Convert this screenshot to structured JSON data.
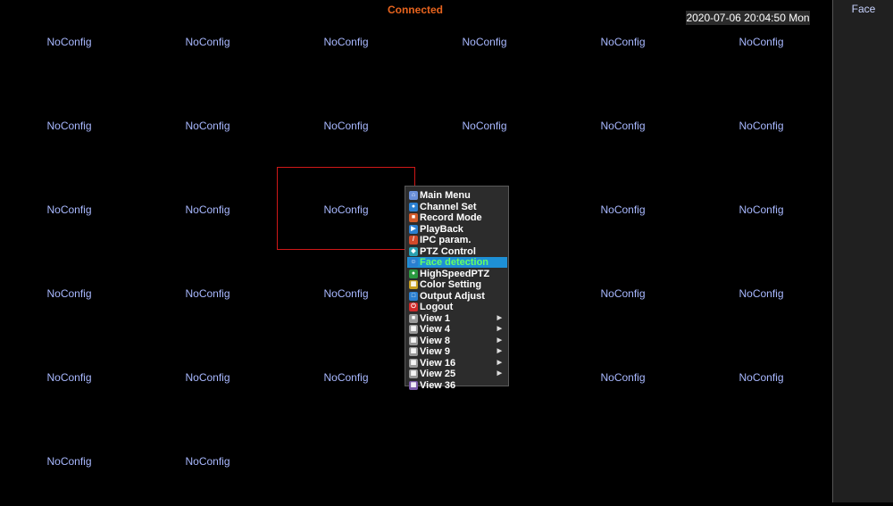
{
  "status": "Connected",
  "datetime": "2020-07-06 20:04:50 Mon",
  "side_panel": {
    "title": "Face"
  },
  "grid": {
    "cell_label": "NoConfig",
    "rows": [
      [
        "NoConfig",
        "NoConfig",
        "NoConfig",
        "NoConfig",
        "NoConfig",
        "NoConfig"
      ],
      [
        "NoConfig",
        "NoConfig",
        "NoConfig",
        "NoConfig",
        "NoConfig",
        "NoConfig"
      ],
      [
        "NoConfig",
        "NoConfig",
        "NoConfig",
        "",
        "NoConfig",
        "NoConfig"
      ],
      [
        "NoConfig",
        "NoConfig",
        "NoConfig",
        "",
        "NoConfig",
        "NoConfig"
      ],
      [
        "NoConfig",
        "NoConfig",
        "NoConfig",
        "",
        "NoConfig",
        "NoConfig"
      ],
      [
        "NoConfig",
        "NoConfig",
        "",
        "",
        "",
        ""
      ]
    ]
  },
  "context_menu": {
    "items": [
      {
        "label": "Main Menu",
        "icon": "home-icon",
        "color": "#6a8fd8",
        "glyph": "⌂"
      },
      {
        "label": "Channel Set",
        "icon": "channel-icon",
        "color": "#2a7fd0",
        "glyph": "●"
      },
      {
        "label": "Record Mode",
        "icon": "record-icon",
        "color": "#d05a2a",
        "glyph": "■"
      },
      {
        "label": "PlayBack",
        "icon": "playback-icon",
        "color": "#2a7fd0",
        "glyph": "▶"
      },
      {
        "label": "IPC param.",
        "icon": "ipc-icon",
        "color": "#d04a2a",
        "glyph": "/"
      },
      {
        "label": "PTZ Control",
        "icon": "ptz-icon",
        "color": "#2aa0b0",
        "glyph": "◆"
      },
      {
        "label": "Face detection",
        "icon": "face-icon",
        "color": "#2a7fd0",
        "glyph": "☺",
        "active": true
      },
      {
        "label": "HighSpeedPTZ",
        "icon": "highspeed-ptz-icon",
        "color": "#2a9a40",
        "glyph": "●"
      },
      {
        "label": "Color Setting",
        "icon": "color-icon",
        "color": "#c8a020",
        "glyph": "▦"
      },
      {
        "label": "Output Adjust",
        "icon": "output-icon",
        "color": "#2a7fd0",
        "glyph": "□"
      },
      {
        "label": "Logout",
        "icon": "logout-icon",
        "color": "#d02a2a",
        "glyph": "⏻"
      },
      {
        "label": "View 1",
        "icon": "view1-icon",
        "color": "#9a9a9a",
        "glyph": "■",
        "submenu": true
      },
      {
        "label": "View 4",
        "icon": "view4-icon",
        "color": "#9a9a9a",
        "glyph": "▦",
        "submenu": true
      },
      {
        "label": "View 8",
        "icon": "view8-icon",
        "color": "#9a9a9a",
        "glyph": "▦",
        "submenu": true
      },
      {
        "label": "View 9",
        "icon": "view9-icon",
        "color": "#9a9a9a",
        "glyph": "▦",
        "submenu": true
      },
      {
        "label": "View 16",
        "icon": "view16-icon",
        "color": "#9a9a9a",
        "glyph": "▦",
        "submenu": true
      },
      {
        "label": "View 25",
        "icon": "view25-icon",
        "color": "#9a9a9a",
        "glyph": "▦",
        "submenu": true
      },
      {
        "label": "View 36",
        "icon": "view36-icon",
        "color": "#7a5aa8",
        "glyph": "▦"
      }
    ]
  }
}
